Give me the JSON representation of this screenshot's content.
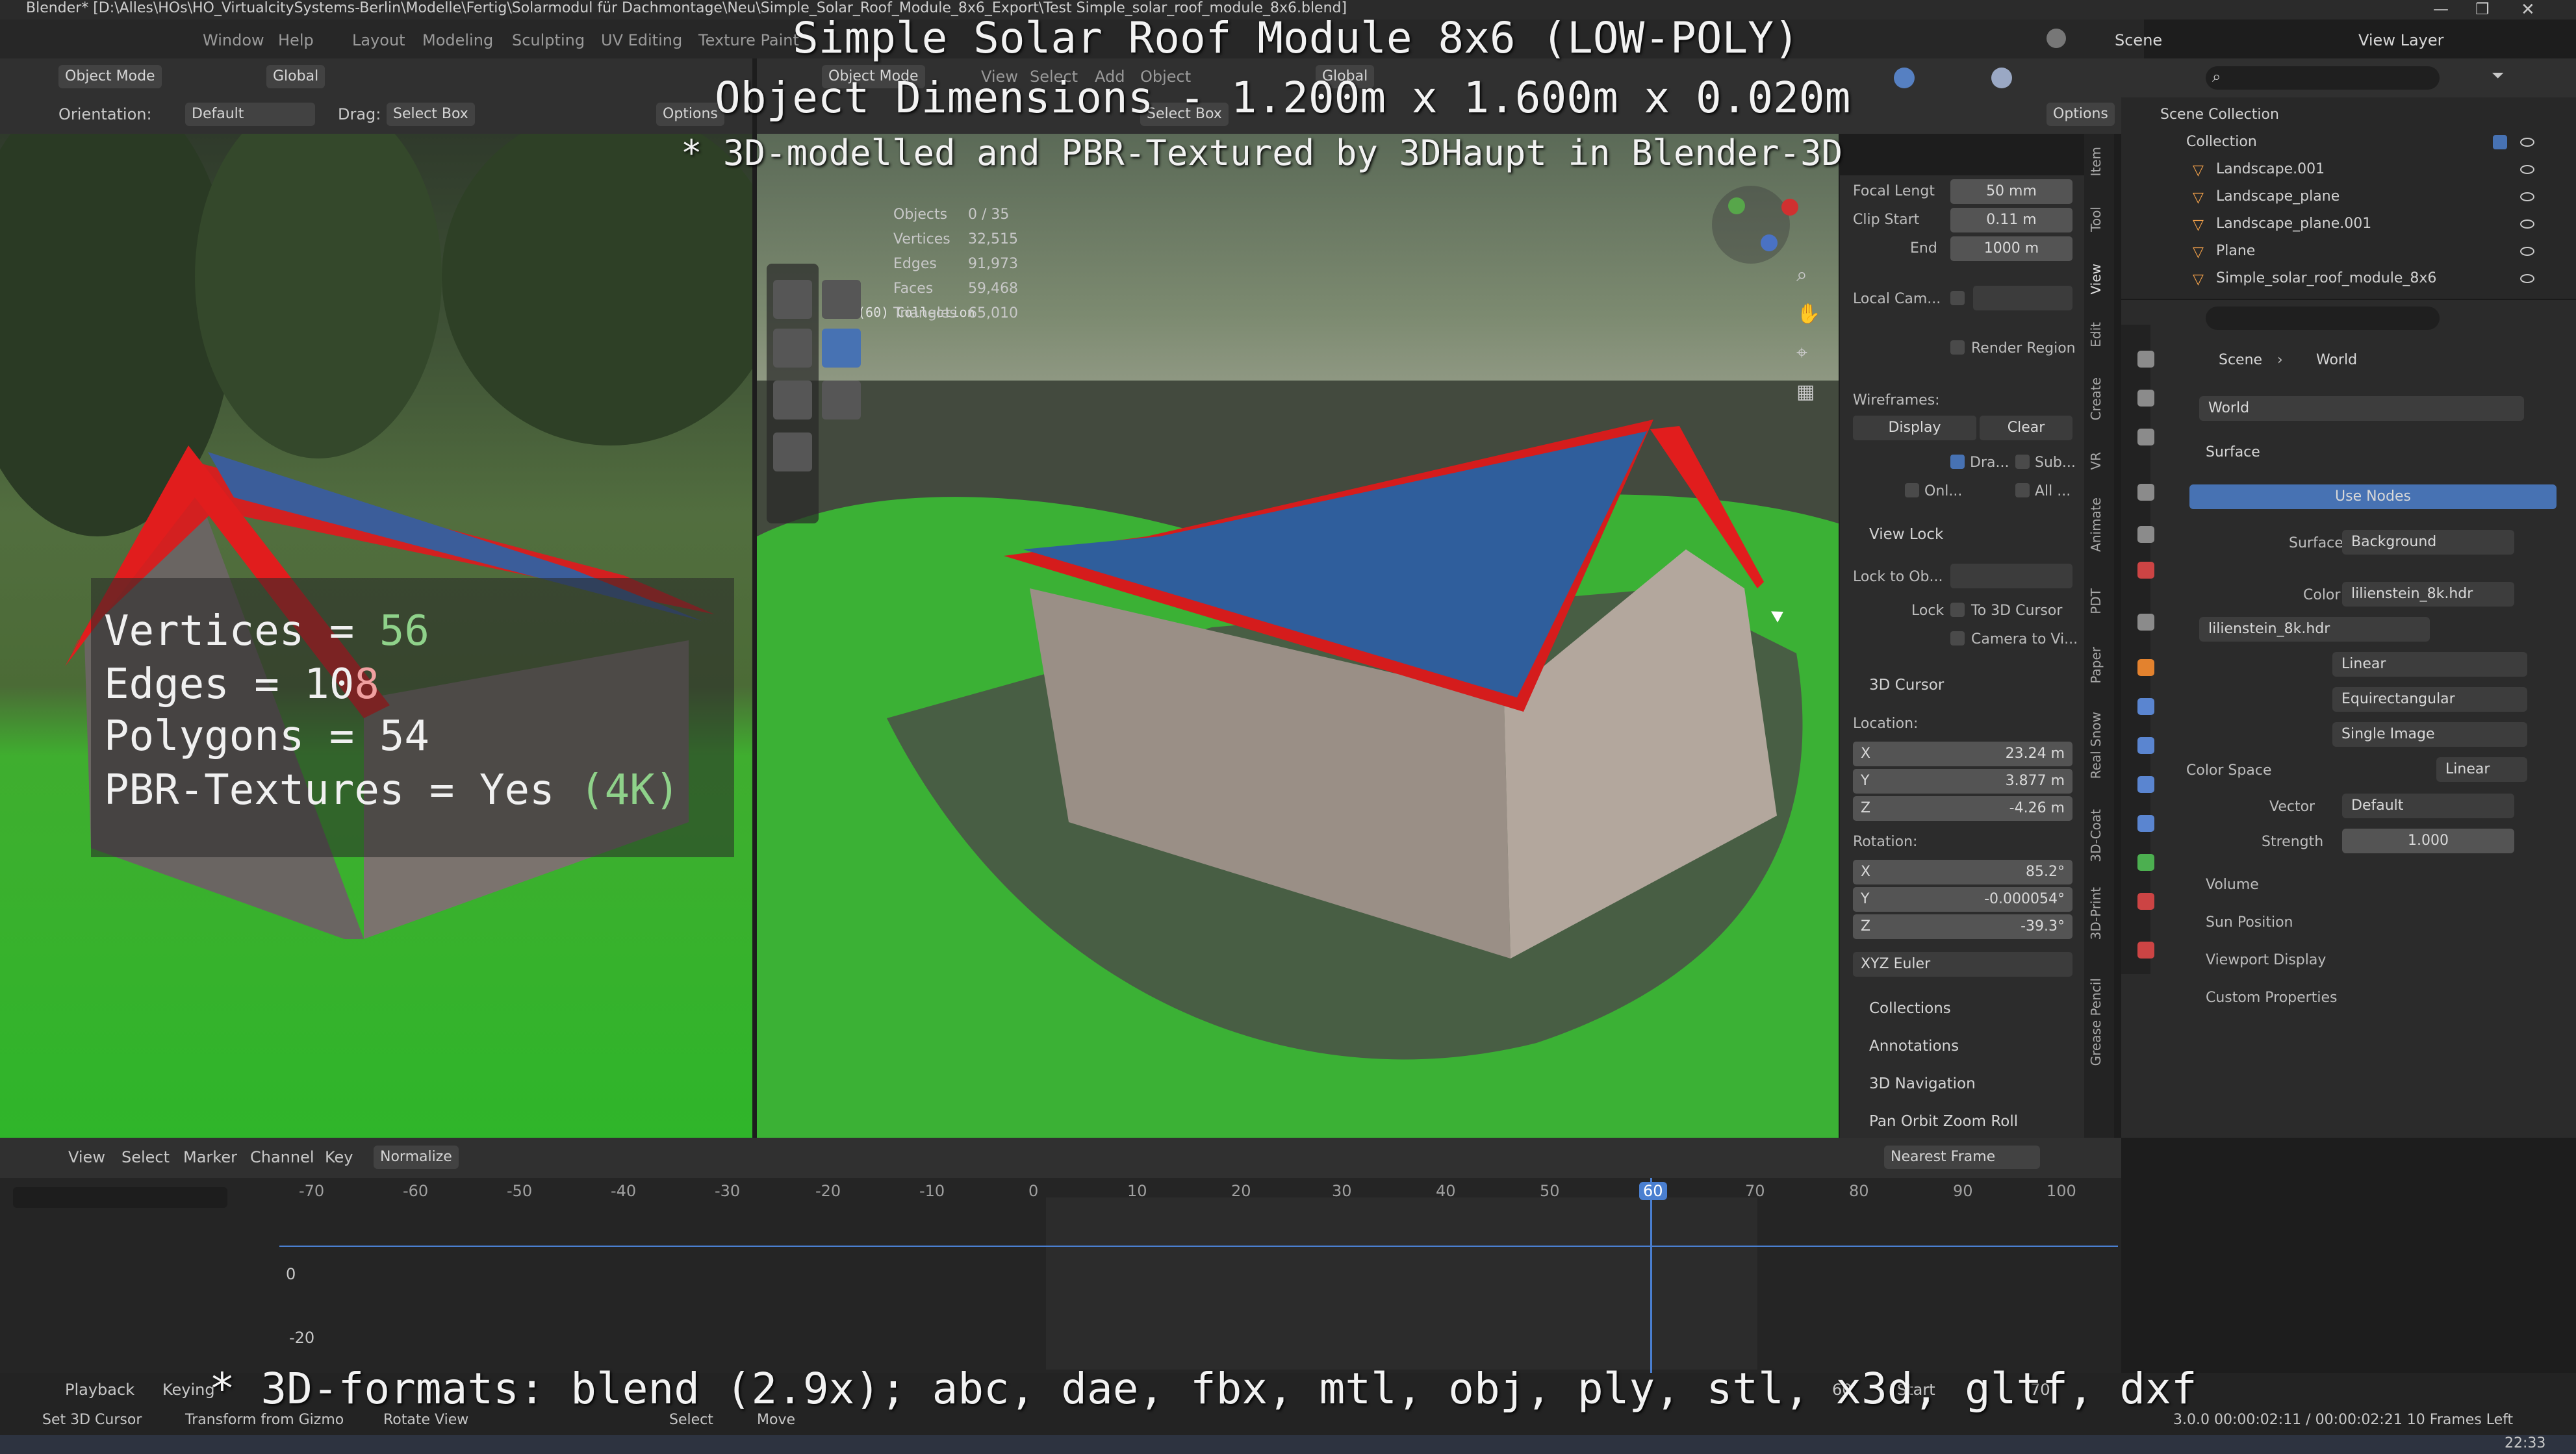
{
  "window": {
    "title": "Blender* [D:\\Alles\\HOs\\HO_VirtualcitySystems-Berlin\\Modelle\\Fertig\\Solarmodul für Dachmontage\\Neu\\Simple_Solar_Roof_Module_8x6_Export\\Test Simple_solar_roof_module_8x6.blend]",
    "menu": [
      "Window",
      "Help"
    ],
    "workspaces": [
      "Layout",
      "Modeling",
      "Sculpting",
      "UV Editing",
      "Texture Paint"
    ],
    "scene_label": "Scene",
    "view_layer_label": "View Layer"
  },
  "overlay": {
    "title_line": "Simple Solar Roof Module 8x6 (LOW-POLY)",
    "dims_line": "Object Dimensions -  1.200m x 1.600m x 0.020m",
    "credit_line": "* 3D-modelled and PBR-Textured by 3DHaupt in Blender-3D",
    "formats_line": "* 3D-formats: blend (2.9x); abc, dae, fbx, mtl, obj, ply, stl, x3d, gltf, dxf",
    "stats": {
      "vertices_label": "Vertices = ",
      "vertices_value": "56",
      "edges_label": "Edges = 10",
      "edges_value": "8",
      "polygons": "Polygons = 54",
      "pbr_label": "PBR-Textures =  Yes ",
      "pbr_value": "(4K)"
    }
  },
  "left_header": {
    "mode": "Object Mode",
    "orientation_label": "Orientation:",
    "orientation_value": "Default",
    "drag_label": "Drag:",
    "drag_value": "Select Box",
    "transform": "Global",
    "options": "Options"
  },
  "right_header": {
    "mode": "Object Mode",
    "menus": [
      "View",
      "Select",
      "Add",
      "Object"
    ],
    "transform": "Global",
    "drag_value": "Select Box",
    "options": "Options"
  },
  "viewport_stats": {
    "collection": "(60) Collection",
    "rows": [
      {
        "label": "Objects",
        "value": "0 / 35"
      },
      {
        "label": "Vertices",
        "value": "32,515"
      },
      {
        "label": "Edges",
        "value": "91,973"
      },
      {
        "label": "Faces",
        "value": "59,468"
      },
      {
        "label": "Triangles",
        "value": "65,010"
      }
    ]
  },
  "npanel": {
    "focal_length_label": "Focal Lengt",
    "focal_length": "50 mm",
    "clip_start_label": "Clip Start",
    "clip_start": "0.11 m",
    "end_label": "End",
    "end": "1000 m",
    "local_cam_label": "Local Cam...",
    "render_region": "Render Region",
    "wireframes_label": "Wireframes:",
    "display": "Display",
    "clear": "Clear",
    "dra": "Dra...",
    "sub": "Sub...",
    "onl": "Onl...",
    "all": "All ...",
    "view_lock": "View Lock",
    "lock_to_obj": "Lock to Ob...",
    "lock_label": "Lock",
    "to_3d_cursor": "To 3D Cursor",
    "camera_to_view": "Camera to Vi...",
    "cursor_section": "3D Cursor",
    "location_label": "Location:",
    "loc": [
      {
        "axis": "X",
        "value": "23.24 m"
      },
      {
        "axis": "Y",
        "value": "3.877 m"
      },
      {
        "axis": "Z",
        "value": "-4.26 m"
      }
    ],
    "rotation_label": "Rotation:",
    "rot": [
      {
        "axis": "X",
        "value": "85.2°"
      },
      {
        "axis": "Y",
        "value": "-0.000054°"
      },
      {
        "axis": "Z",
        "value": "-39.3°"
      }
    ],
    "rot_mode": "XYZ Euler",
    "sections": [
      "Collections",
      "Annotations",
      "3D Navigation",
      "Pan Orbit Zoom Roll"
    ]
  },
  "vtabs": [
    "Item",
    "Tool",
    "View",
    "Edit",
    "Create",
    "VR",
    "Animate",
    "PDT",
    "Paper",
    "Real Snow",
    "3D-Coat",
    "3D-Print",
    "Grease Pencil"
  ],
  "outliner": {
    "root": "Scene Collection",
    "collection": "Collection",
    "items": [
      "Landscape.001",
      "Landscape_plane",
      "Landscape_plane.001",
      "Plane",
      "Simple_solar_roof_module_8x6"
    ]
  },
  "properties": {
    "breadcrumb_scene": "Scene",
    "breadcrumb_world": "World",
    "world_name": "World",
    "surface_section": "Surface",
    "use_nodes": "Use Nodes",
    "surface_label": "Surface",
    "surface_value": "Background",
    "color_label": "Color",
    "color_value": "lilienstein_8k.hdr",
    "image_name": "lilienstein_8k.hdr",
    "interp": "Linear",
    "projection": "Equirectangular",
    "source": "Single Image",
    "color_space_label": "Color Space",
    "color_space": "Linear",
    "vector_label": "Vector",
    "vector_value": "Default",
    "strength_label": "Strength",
    "strength_value": "1.000",
    "panels": [
      "Volume",
      "Sun Position",
      "Viewport Display",
      "Custom Properties"
    ]
  },
  "timeline": {
    "menus": [
      "View",
      "Select",
      "Marker",
      "Channel",
      "Key"
    ],
    "normalize": "Normalize",
    "snap": "Nearest Frame",
    "ticks": [
      "-70",
      "-60",
      "-50",
      "-40",
      "-30",
      "-20",
      "-10",
      "0",
      "10",
      "20",
      "30",
      "40",
      "50",
      "60",
      "70",
      "80",
      "90",
      "100"
    ],
    "current_frame": "60",
    "y_labels": [
      "0",
      "-20"
    ]
  },
  "statusbar": {
    "playback": "Playback",
    "keying": "Keying",
    "set_cursor": "Set 3D Cursor",
    "transform_gizmo": "Transform from Gizmo",
    "rotate_view": "Rotate View",
    "select": "Select",
    "move": "Move",
    "start_label": "Start",
    "start_value": "60",
    "end_value": "70",
    "version_info": "3.0.0  00:00:02:11 / 00:00:02:21  10 Frames Left",
    "clock": "22:33"
  },
  "colors": {
    "accent_blue": "#4772b3",
    "frame_marker": "#4a7fd0",
    "roof_red": "#e11d1d",
    "grass_green": "#37c531"
  }
}
